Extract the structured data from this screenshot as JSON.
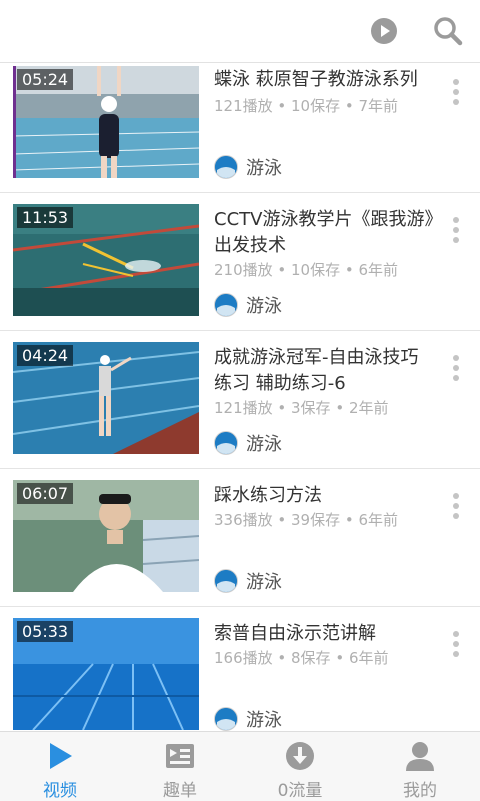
{
  "colors": {
    "accent": "#2a8fe0",
    "icon_gray": "#9b9b9b",
    "meta_gray": "#b0b0b0"
  },
  "header": {
    "icons": [
      "play-icon",
      "search-icon"
    ]
  },
  "videos": [
    {
      "duration": "05:24",
      "title": "蝶泳 萩原智子教游泳系列",
      "meta": "121播放 • 10保存 • 7年前",
      "channel": "游泳"
    },
    {
      "duration": "11:53",
      "title": "CCTV游泳教学片《跟我游》出发技术",
      "meta": "210播放 • 10保存 • 6年前",
      "channel": "游泳"
    },
    {
      "duration": "04:24",
      "title": "成就游泳冠军-自由泳技巧练习 辅助练习-6",
      "meta": "121播放 • 3保存 • 2年前",
      "channel": "游泳"
    },
    {
      "duration": "06:07",
      "title": "踩水练习方法",
      "meta": "336播放 • 39保存 • 6年前",
      "channel": "游泳"
    },
    {
      "duration": "05:33",
      "title": "索普自由泳示范讲解",
      "meta": "166播放 • 8保存 • 6年前",
      "channel": "游泳"
    }
  ],
  "tabs": [
    {
      "label": "视频",
      "icon": "play-triangle-icon",
      "active": true
    },
    {
      "label": "趣单",
      "icon": "playlist-icon",
      "active": false
    },
    {
      "label": "0流量",
      "icon": "download-icon",
      "active": false
    },
    {
      "label": "我的",
      "icon": "user-icon",
      "active": false
    }
  ]
}
